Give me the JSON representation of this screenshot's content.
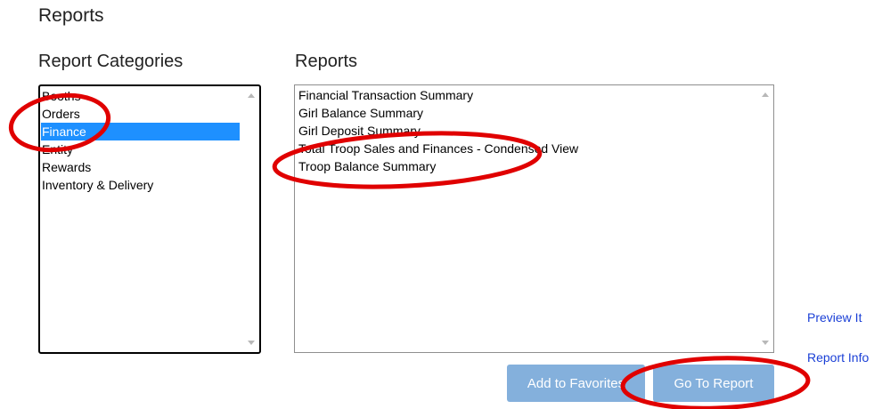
{
  "page": {
    "title": "Reports"
  },
  "categories": {
    "heading": "Report Categories",
    "items": [
      {
        "label": "Booths"
      },
      {
        "label": "Orders"
      },
      {
        "label": "Finance"
      },
      {
        "label": "Entity"
      },
      {
        "label": "Rewards"
      },
      {
        "label": "Inventory & Delivery"
      }
    ],
    "selected_label": "Finance"
  },
  "reports": {
    "heading": "Reports",
    "items": [
      {
        "label": "Financial Transaction Summary"
      },
      {
        "label": "Girl Balance Summary"
      },
      {
        "label": "Girl Deposit Summary"
      },
      {
        "label": "Total Troop Sales and Finances - Condensed View"
      },
      {
        "label": "Troop Balance Summary"
      }
    ]
  },
  "links": {
    "preview": "Preview It",
    "report_info": "Report Info"
  },
  "buttons": {
    "add_to_favorites": "Add to Favorites",
    "go_to_report": "Go To Report"
  },
  "colors": {
    "selection": "#1e90ff",
    "button_bg": "#84b0dc",
    "link": "#1a3fd6",
    "annotation": "#e00000"
  }
}
